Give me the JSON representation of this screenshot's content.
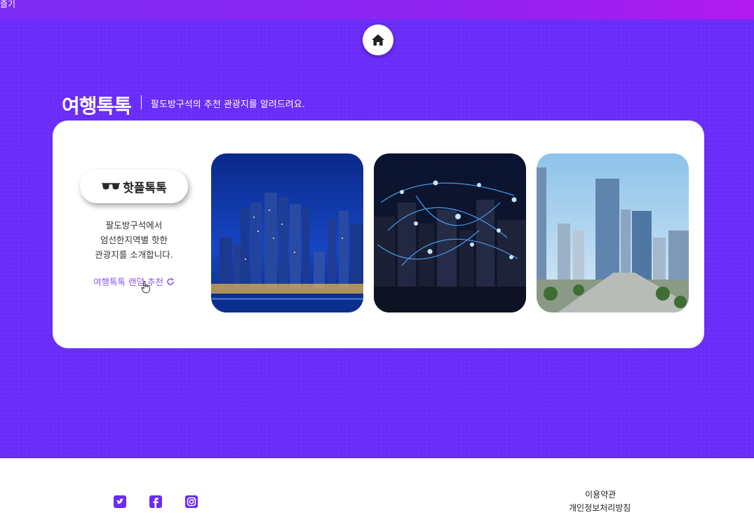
{
  "topbar": {
    "text": "즐기"
  },
  "header": {
    "title": "여행톡톡",
    "subtitle": "팔도방구석의 추천 관광지를 알려드려요."
  },
  "card": {
    "hot_button_label": "핫플톡톡",
    "description_lines": [
      "팔도방구석에서",
      "엄선한지역별 핫한",
      "관광지를 소개합니다."
    ],
    "random_link_label": "여행톡톡 랜덤 추천",
    "photos": [
      {
        "name": "night-city-skyline-photo"
      },
      {
        "name": "network-city-photo"
      },
      {
        "name": "daytime-city-photo"
      }
    ]
  },
  "footer": {
    "social": [
      "twitter-icon",
      "facebook-icon",
      "instagram-icon"
    ],
    "links": [
      "이용약관",
      "개인정보처리방침"
    ]
  },
  "colors": {
    "primary_purple": "#6a2cf9",
    "topbar_gradient_end": "#b21bf0",
    "link_purple": "#8a58f2",
    "footer_icon": "#6a2cf9"
  }
}
